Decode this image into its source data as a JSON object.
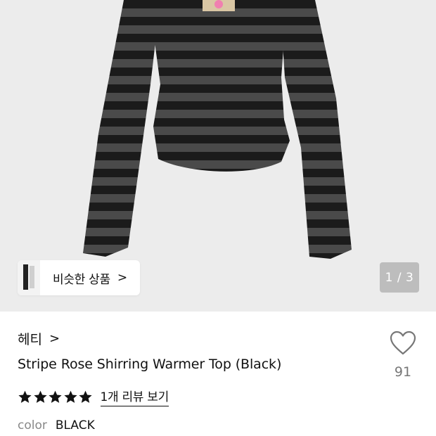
{
  "hero": {
    "similar_label": "비슷한 상품",
    "similar_chevron": ">",
    "pager": "1 / 3"
  },
  "product": {
    "brand": "헤티",
    "brand_chevron": ">",
    "title": "Stripe Rose Shirring Warmer Top (Black)",
    "like_count": "91",
    "rating_stars": 5,
    "reviews_link": "1개 리뷰 보기",
    "color_label": "color",
    "color_value": "BLACK"
  },
  "colors": {
    "hero_bg": "#ececec",
    "stripe_dark": "#1b1b1b",
    "stripe_light": "#4a4a4a",
    "pager_bg": "#bdbdbd"
  }
}
